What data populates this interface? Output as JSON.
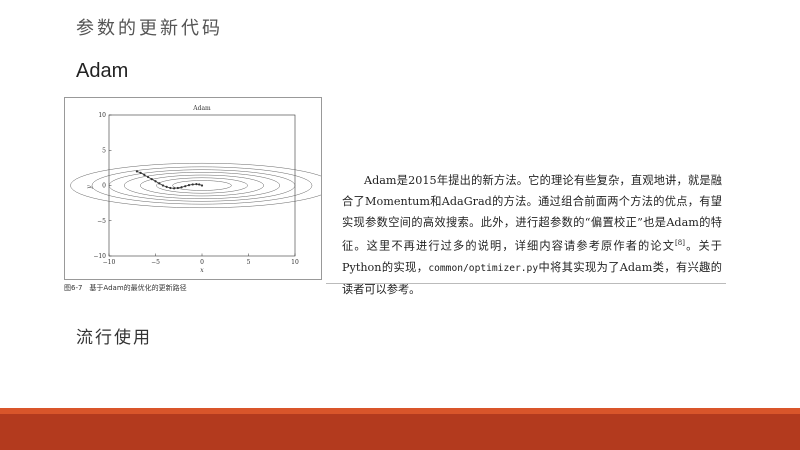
{
  "slide": {
    "title": "参数的更新代码",
    "section_heading": "Adam",
    "bottom_heading": "流行使用"
  },
  "figure": {
    "caption": "图6-7　基于Adam的最优化的更新路径"
  },
  "paragraph": {
    "part1": "Adam是2015年提出的新方法。它的理论有些复杂，直观地讲，就是融合了Momentum和AdaGrad的方法。通过组合前面两个方法的优点，有望实现参数空间的高效搜索。此外，进行超参数的“偏置校正”也是Adam的特征。这里不再进行过多的说明，详细内容请参考原作者的论文",
    "citation": "[8]",
    "part2": "。关于Python的实现，",
    "code": "common/optimizer.py",
    "part3": "中将其实现为了Adam类，有兴趣的读者可以参考。"
  },
  "colors": {
    "footer_band": "#b33a1e",
    "footer_band_top": "#d9552a",
    "path": "#333333",
    "contour": "#555555"
  },
  "chart_data": {
    "type": "line",
    "title": "Adam",
    "xlabel": "x",
    "ylabel": "y",
    "xlim": [
      -10,
      10
    ],
    "ylim": [
      -10,
      10
    ],
    "xticks": [
      -10,
      -5,
      0,
      5,
      10
    ],
    "yticks": [
      -10,
      -5,
      0,
      5,
      10
    ],
    "xtick_labels": [
      "−10",
      "−5",
      "0",
      "5",
      "10"
    ],
    "ytick_labels": [
      "−10",
      "−5",
      "0",
      "5",
      "10"
    ],
    "contour_levels": [
      0.5,
      1.2,
      2.2,
      3.5,
      5,
      7,
      10
    ],
    "path": {
      "x": [
        -7.0,
        -6.6,
        -6.2,
        -5.8,
        -5.4,
        -5.0,
        -4.6,
        -4.2,
        -3.8,
        -3.4,
        -3.0,
        -2.6,
        -2.2,
        -1.8,
        -1.4,
        -1.0,
        -0.6,
        -0.3,
        0.0
      ],
      "y": [
        2.0,
        1.8,
        1.5,
        1.2,
        0.9,
        0.6,
        0.3,
        0.0,
        -0.2,
        -0.35,
        -0.4,
        -0.35,
        -0.25,
        -0.1,
        0.05,
        0.15,
        0.2,
        0.15,
        0.0
      ]
    },
    "grid": false
  }
}
